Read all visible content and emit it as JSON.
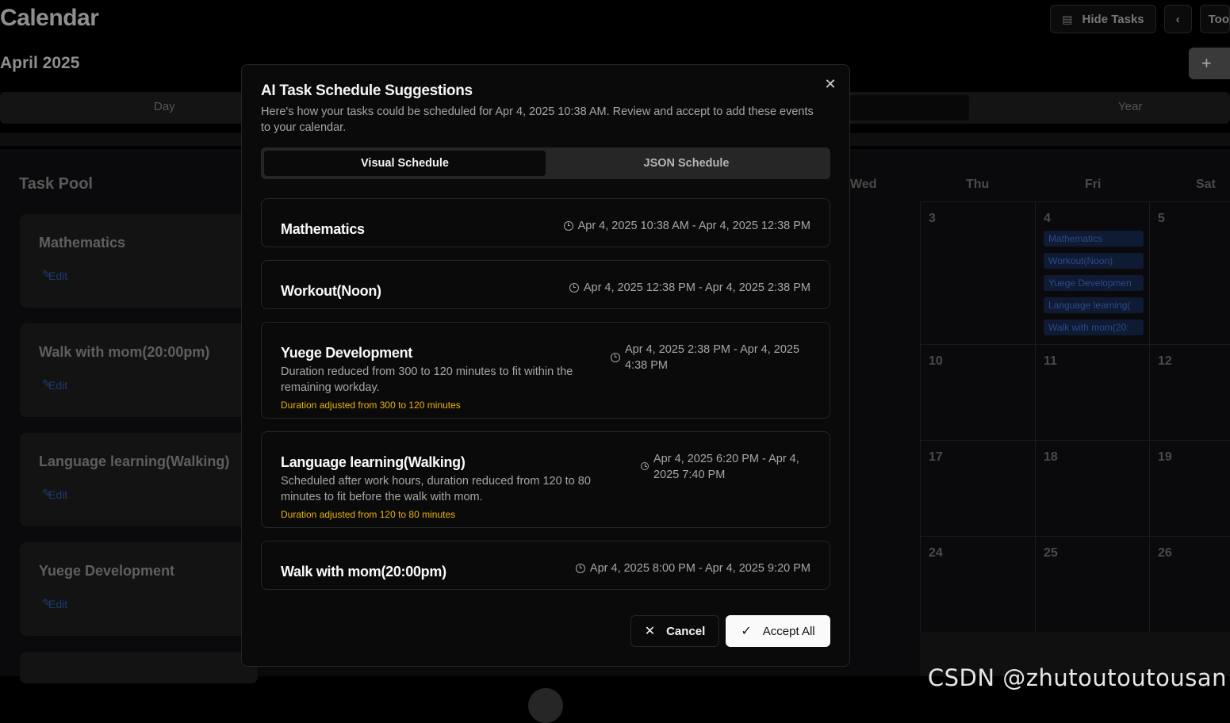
{
  "app": {
    "title": "Calendar",
    "month": "April 2025",
    "hide_tasks_label": "Hide Tasks",
    "prev_label": "‹",
    "today_label": "Too",
    "add_label": "+",
    "view_tabs": [
      "Day",
      "Year"
    ]
  },
  "task_pool": {
    "title": "Task Pool",
    "edit_label": "Edit",
    "tasks": [
      "Mathematics",
      "Walk with mom(20:00pm)",
      "Language learning(Walking)",
      "Yuege Development"
    ]
  },
  "calendar": {
    "days": [
      "Wed",
      "Thu",
      "Fri",
      "Sat"
    ],
    "row1": [
      "3",
      "4",
      "5"
    ],
    "row2": [
      "10",
      "11",
      "12"
    ],
    "row3": [
      "17",
      "18",
      "19"
    ],
    "row4": [
      "24",
      "25",
      "26"
    ],
    "fri_events": [
      "Mathematics",
      "Workout(Noon)",
      "Yuege Developmen",
      "Language learning(",
      "Walk with mom(20:"
    ]
  },
  "modal": {
    "title": "AI Task Schedule Suggestions",
    "description": "Here's how your tasks could be scheduled for Apr 4, 2025 10:38 AM. Review and accept to add these events to your calendar.",
    "tabs": {
      "visual": "Visual Schedule",
      "json": "JSON Schedule"
    },
    "cards": [
      {
        "name": "Mathematics",
        "time": "Apr 4, 2025 10:38 AM - Apr 4, 2025 12:38 PM"
      },
      {
        "name": "Workout(Noon)",
        "time": "Apr 4, 2025 12:38 PM - Apr 4, 2025 2:38 PM"
      },
      {
        "name": "Yuege Development",
        "time": "Apr 4, 2025 2:38 PM - Apr 4, 2025 4:38 PM",
        "reason": "Duration reduced from 300 to 120 minutes to fit within the remaining workday.",
        "adjustment": "Duration adjusted from 300 to 120 minutes"
      },
      {
        "name": "Language learning(Walking)",
        "time": "Apr 4, 2025 6:20 PM - Apr 4, 2025 7:40 PM",
        "reason": "Scheduled after work hours, duration reduced from 120 to 80 minutes to fit before the walk with mom.",
        "adjustment": "Duration adjusted from 120 to 80 minutes"
      },
      {
        "name": "Walk with mom(20:00pm)",
        "time": "Apr 4, 2025 8:00 PM - Apr 4, 2025 9:20 PM"
      }
    ],
    "cancel_label": "Cancel",
    "accept_label": "Accept All"
  },
  "watermark": "CSDN @zhutoutoutousan",
  "colors": {
    "accent_warning": "#eab308",
    "modal_bg": "#0a0a0a",
    "border": "#262626"
  }
}
